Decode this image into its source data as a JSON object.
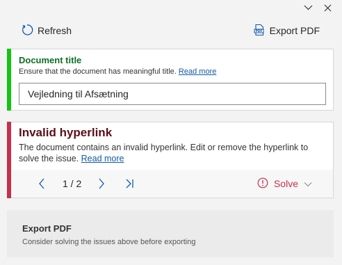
{
  "window": {
    "controls": [
      "chevron-down",
      "close"
    ]
  },
  "toolbar": {
    "refresh_label": "Refresh",
    "export_label": "Export PDF"
  },
  "document_title_card": {
    "heading": "Document title",
    "description": "Ensure that the document has meaningful title.",
    "read_more": "Read more",
    "input_value": "Vejledning til Afsætning",
    "status_color": "#14c414"
  },
  "hyperlink_card": {
    "heading": "Invalid hyperlink",
    "description": "The document contains an invalid hyperlink. Edit or remove the hyperlink to solve the issue.",
    "read_more": "Read more",
    "pager": "1 / 2",
    "solve_label": "Solve",
    "status_color": "#c4314b"
  },
  "export_section": {
    "heading": "Export PDF",
    "description": "Consider solving the issues above before exporting"
  }
}
